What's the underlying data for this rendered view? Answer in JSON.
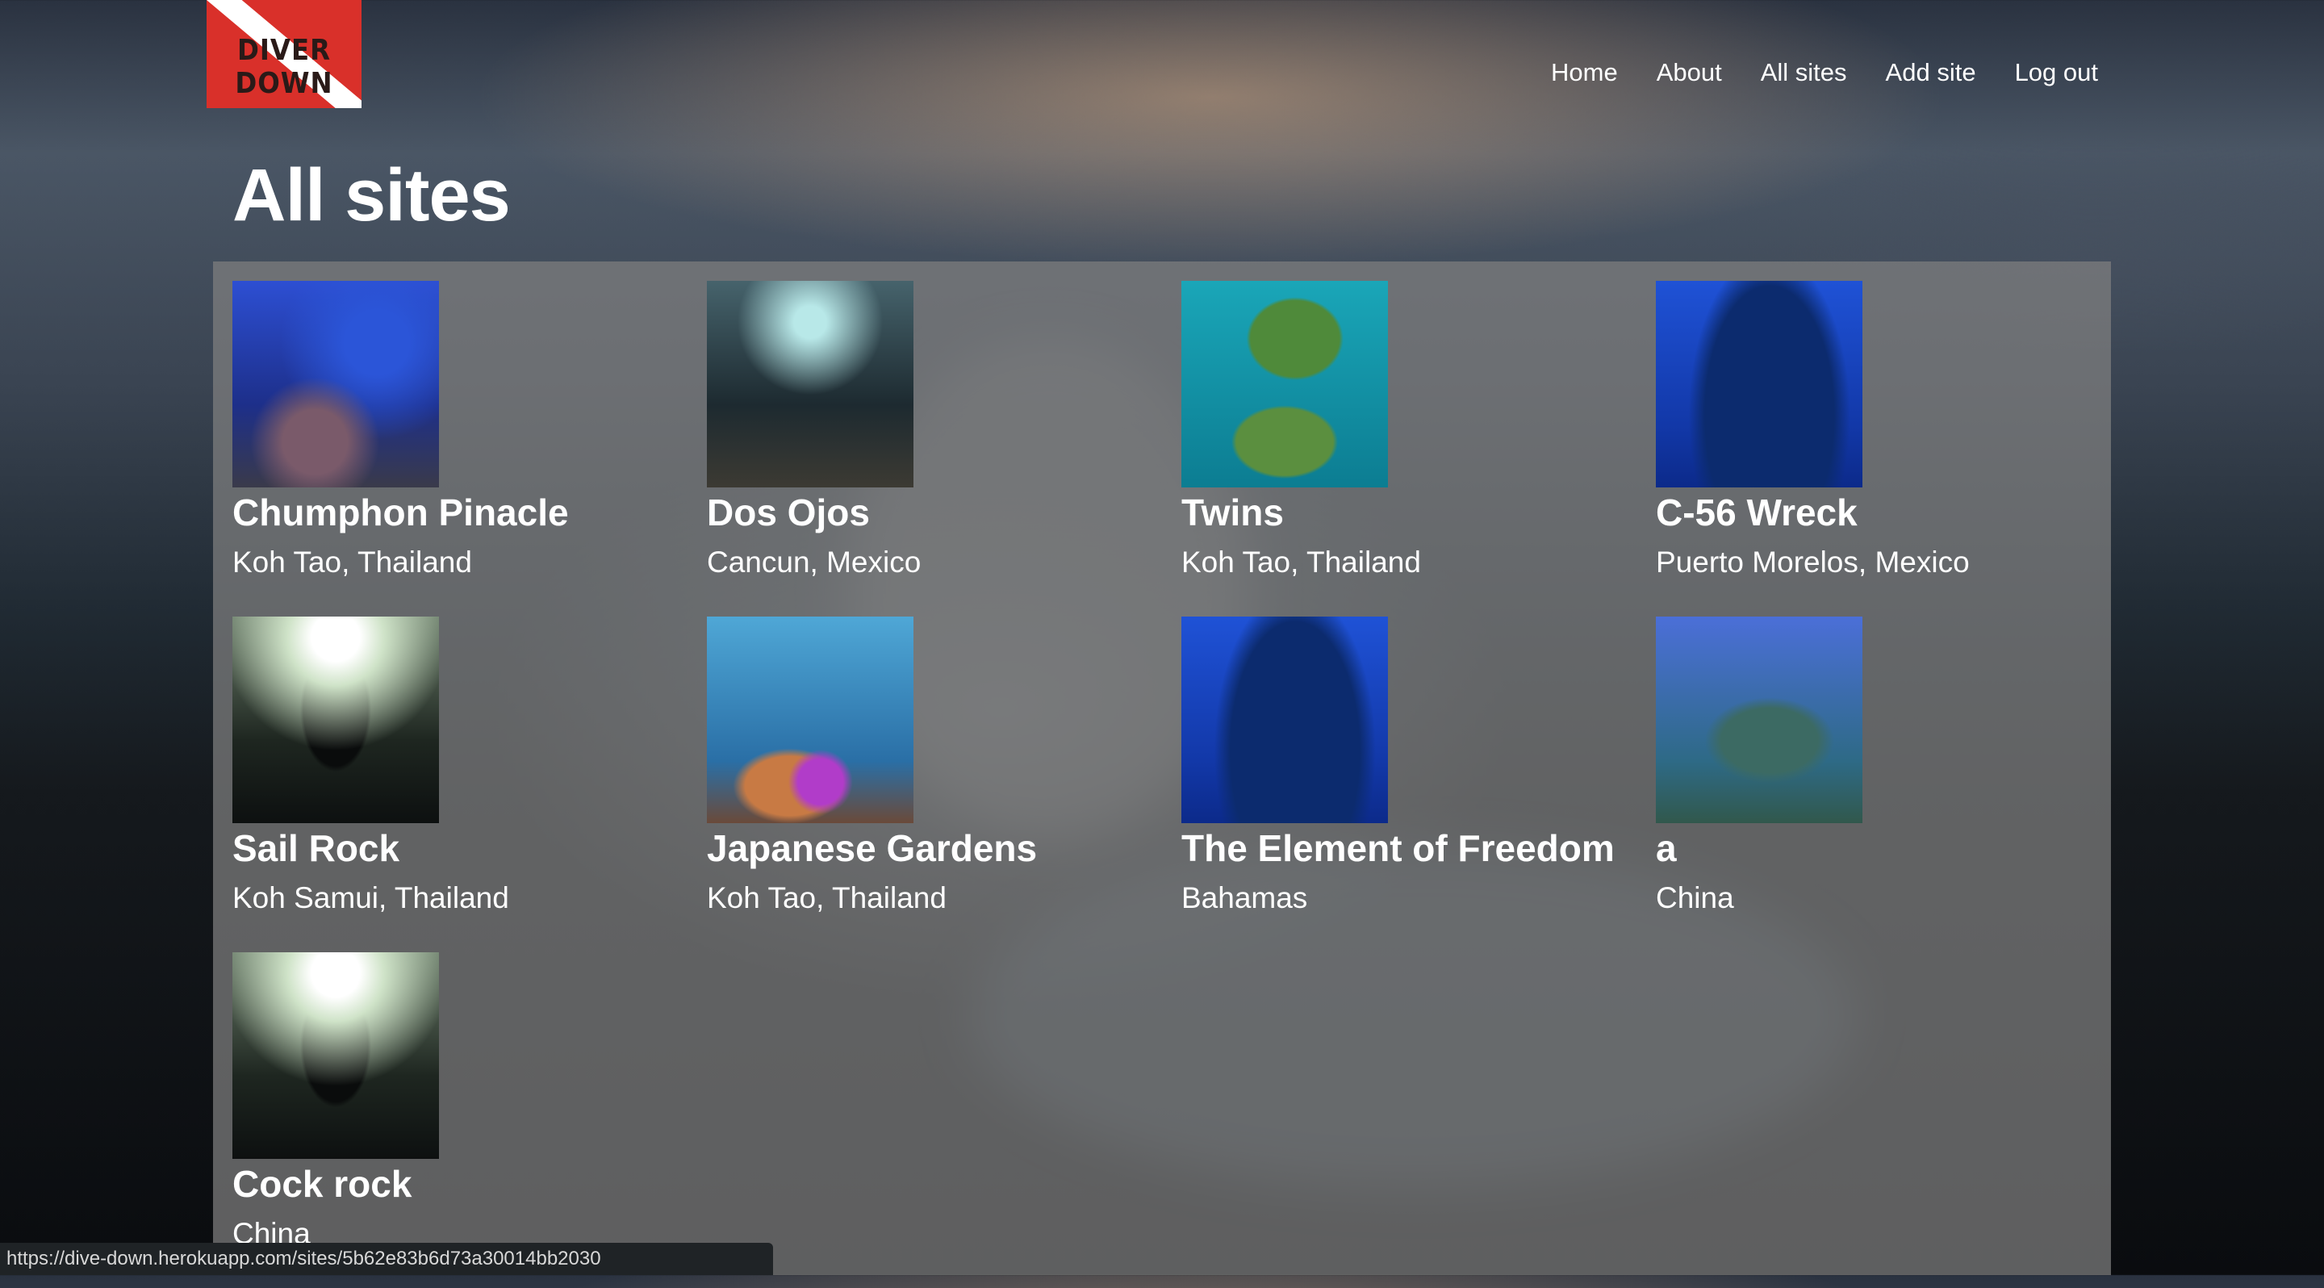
{
  "logo": {
    "text": "DIVER DOWN"
  },
  "nav": [
    {
      "label": "Home"
    },
    {
      "label": "About"
    },
    {
      "label": "All sites"
    },
    {
      "label": "Add site"
    },
    {
      "label": "Log out"
    }
  ],
  "page": {
    "title": "All sites"
  },
  "sites": [
    {
      "name": "Chumphon Pinacle",
      "location": "Koh Tao, Thailand",
      "image": "reef-fish"
    },
    {
      "name": "Dos Ojos",
      "location": "Cancun, Mexico",
      "image": "cenote-cave"
    },
    {
      "name": "Twins",
      "location": "Koh Tao, Thailand",
      "image": "tropical-islands"
    },
    {
      "name": "C-56 Wreck",
      "location": "Puerto Morelos, Mexico",
      "image": "shipwreck"
    },
    {
      "name": "Sail Rock",
      "location": "Koh Samui, Thailand",
      "image": "diver-silhouette"
    },
    {
      "name": "Japanese Gardens",
      "location": "Koh Tao, Thailand",
      "image": "coral-garden"
    },
    {
      "name": "The Element of Freedom",
      "location": "Bahamas",
      "image": "shipwreck"
    },
    {
      "name": "a",
      "location": "China",
      "image": "sunken-plane"
    },
    {
      "name": "Cock rock",
      "location": "China",
      "image": "diver-silhouette"
    }
  ],
  "status_bar": {
    "url": "https://dive-down.herokuapp.com/sites/5b62e83b6d73a30014bb2030"
  },
  "colors": {
    "logo_red": "#d9302a",
    "panel": "rgba(128,128,128,0.72)"
  }
}
